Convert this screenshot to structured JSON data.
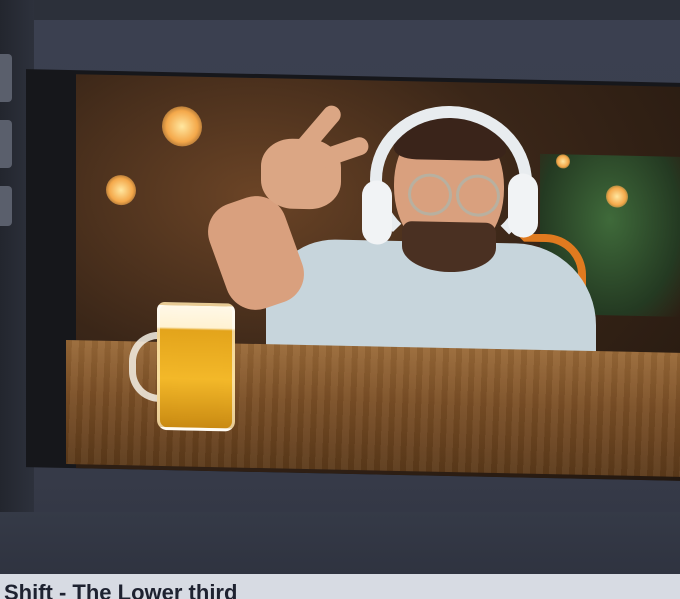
{
  "caption": {
    "text": "Shift - The  Lower  third"
  },
  "preview": {
    "scene": "webcam-overlay"
  },
  "colors": {
    "app_background": "#3a3f4e",
    "preview_border": "#16171b",
    "caption_background": "#d7dbe3",
    "caption_text": "#1e2230",
    "beer": "#f3b829",
    "chair_accent": "#e07a1f"
  },
  "icons": [
    "beer-mug-icon"
  ]
}
